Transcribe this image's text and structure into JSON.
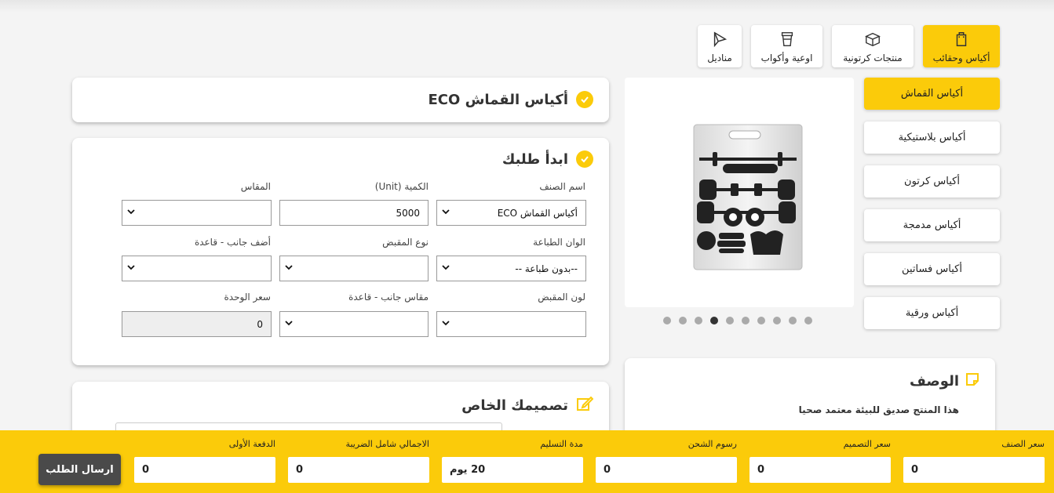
{
  "categories": [
    {
      "label": "أكياس وحقائب",
      "icon": "bag-icon",
      "active": true
    },
    {
      "label": "منتجات كرتونية",
      "icon": "box-icon",
      "active": false
    },
    {
      "label": "اوعية وأكواب",
      "icon": "cup-icon",
      "active": false
    },
    {
      "label": "مناديل",
      "icon": "napkin-icon",
      "active": false
    }
  ],
  "side_menu": [
    {
      "label": "أكياس القماش",
      "active": true
    },
    {
      "label": "أكياس بلاستيكية",
      "active": false
    },
    {
      "label": "أكياس كرتون",
      "active": false
    },
    {
      "label": "أكياس مدمجة",
      "active": false
    },
    {
      "label": "أكياس فساتين",
      "active": false
    },
    {
      "label": "أكياس ورقية",
      "active": false
    }
  ],
  "carousel": {
    "dot_count": 10,
    "active_index": 3
  },
  "product_card": {
    "title": "أكياس القماش ECO"
  },
  "order_card": {
    "title": "ابدأ طلبك",
    "fields": {
      "item_name": {
        "label": "اسم الصنف",
        "value": "أكياس القماش ECO"
      },
      "quantity": {
        "label": "الكمية (Unit)",
        "value": "5000"
      },
      "size": {
        "label": "المقاس",
        "value": ""
      },
      "print_colors": {
        "label": "الوان الطباعة",
        "value": "--بدون طباعة --"
      },
      "handle_type": {
        "label": "نوع المقبض",
        "value": ""
      },
      "add_side_base": {
        "label": "أضف جانب - قاعدة",
        "value": ""
      },
      "handle_color": {
        "label": "لون المقبض",
        "value": ""
      },
      "side_base_size": {
        "label": "مقاس جانب - قاعدة",
        "value": ""
      },
      "unit_price": {
        "label": "سعر الوحدة",
        "value": "0"
      }
    }
  },
  "design_card": {
    "title": "تصميمك الخاص"
  },
  "description": {
    "title": "الوصف",
    "text": "هذا المنتج صديق للبيئة معتمد صحيا"
  },
  "bottom_bar": {
    "item_price": {
      "label": "سعر الصنف",
      "value": "0"
    },
    "design_price": {
      "label": "سعر التصميم",
      "value": "0"
    },
    "shipping_fees": {
      "label": "رسوم الشحن",
      "value": "0"
    },
    "delivery_time": {
      "label": "مدة التسليم",
      "value": "20 يوم"
    },
    "total_with_tax": {
      "label": "الاجمالي شامل الضريبة",
      "value": "0"
    },
    "down_payment": {
      "label": "الدفعة الأولى",
      "value": "0"
    },
    "submit_label": "ارسال الطلب"
  },
  "colors": {
    "accent": "#fbcb0a",
    "dark_button": "#4a4a4a"
  }
}
